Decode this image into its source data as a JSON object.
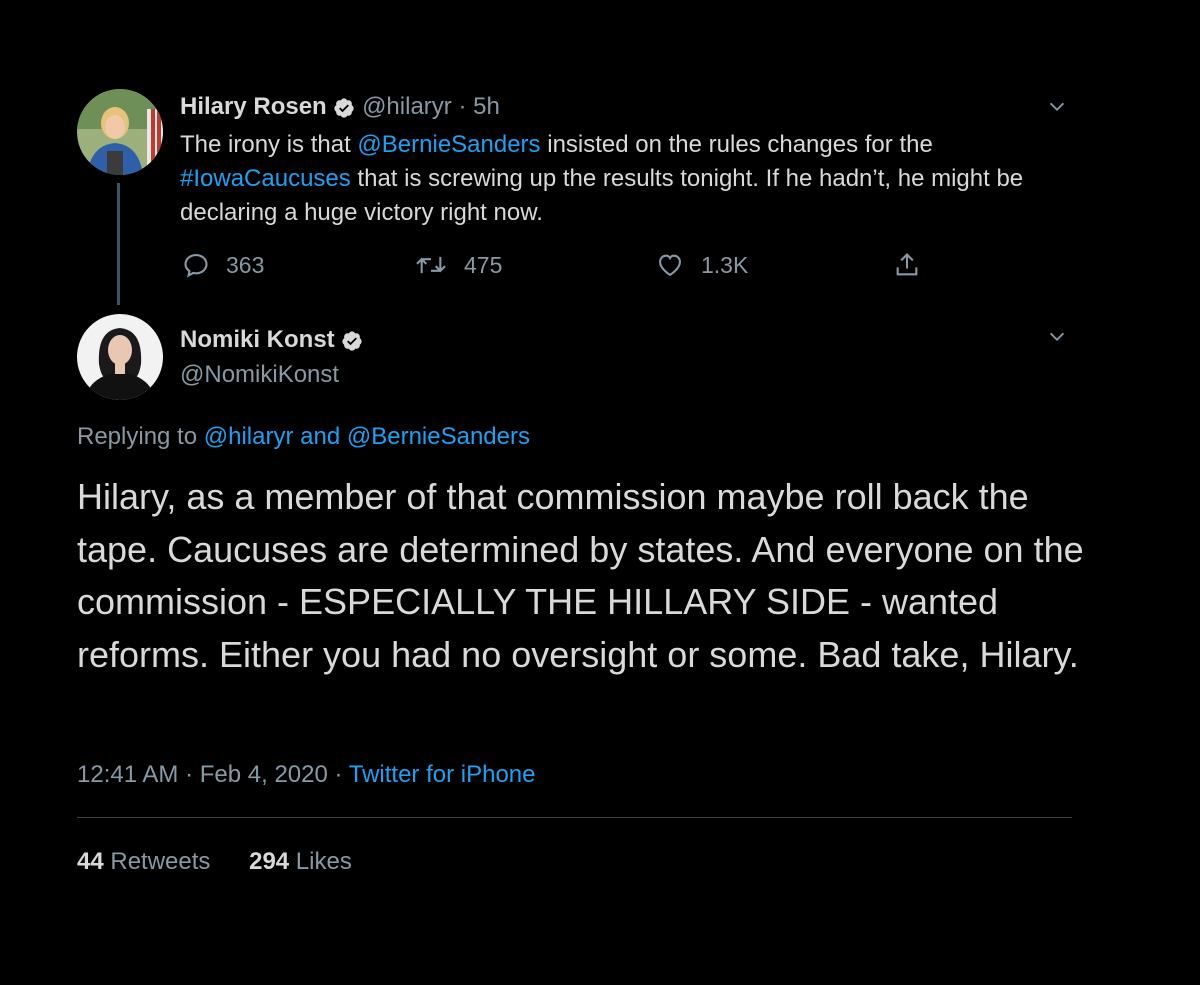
{
  "parent_tweet": {
    "name": "Hilary Rosen",
    "handle": "@hilaryr",
    "separator": "·",
    "time": "5h",
    "text": {
      "p1": "The irony is that ",
      "mention": "@BernieSanders",
      "p2": " insisted on the rules changes for the ",
      "hashtag": "#IowaCaucuses",
      "p3": " that is screwing up the results tonight. If he hadn’t, he might be declaring a huge victory right now."
    },
    "actions": {
      "replies": "363",
      "retweets": "475",
      "likes": "1.3K"
    }
  },
  "reply_tweet": {
    "name": "Nomiki Konst",
    "handle": "@NomikiKonst",
    "replying": {
      "prefix": "Replying to ",
      "mention1": "@hilaryr",
      "and": " and ",
      "mention2": "@BernieSanders"
    },
    "text": "Hilary, as a member of that commission maybe roll back the tape. Caucuses are determined by states. And everyone on the commission - ESPECIALLY THE HILLARY SIDE - wanted reforms. Either you had no oversight or some. Bad take, Hilary.",
    "meta": {
      "time": "12:41 AM",
      "sep1": " · ",
      "date": "Feb 4, 2020",
      "sep2": " · ",
      "source": "Twitter for iPhone"
    },
    "stats": {
      "retweets_count": "44",
      "retweets_label": " Retweets",
      "likes_count": "294",
      "likes_label": " Likes"
    }
  },
  "colors": {
    "background": "#000000",
    "text": "#d9d9d9",
    "secondary": "#8899a6",
    "link": "#1da1f2",
    "thread_line": "#3d5466",
    "divider": "#38444d"
  },
  "icons": [
    "verified-badge-icon",
    "chevron-down-icon",
    "reply-icon",
    "retweet-icon",
    "like-icon",
    "share-icon"
  ]
}
